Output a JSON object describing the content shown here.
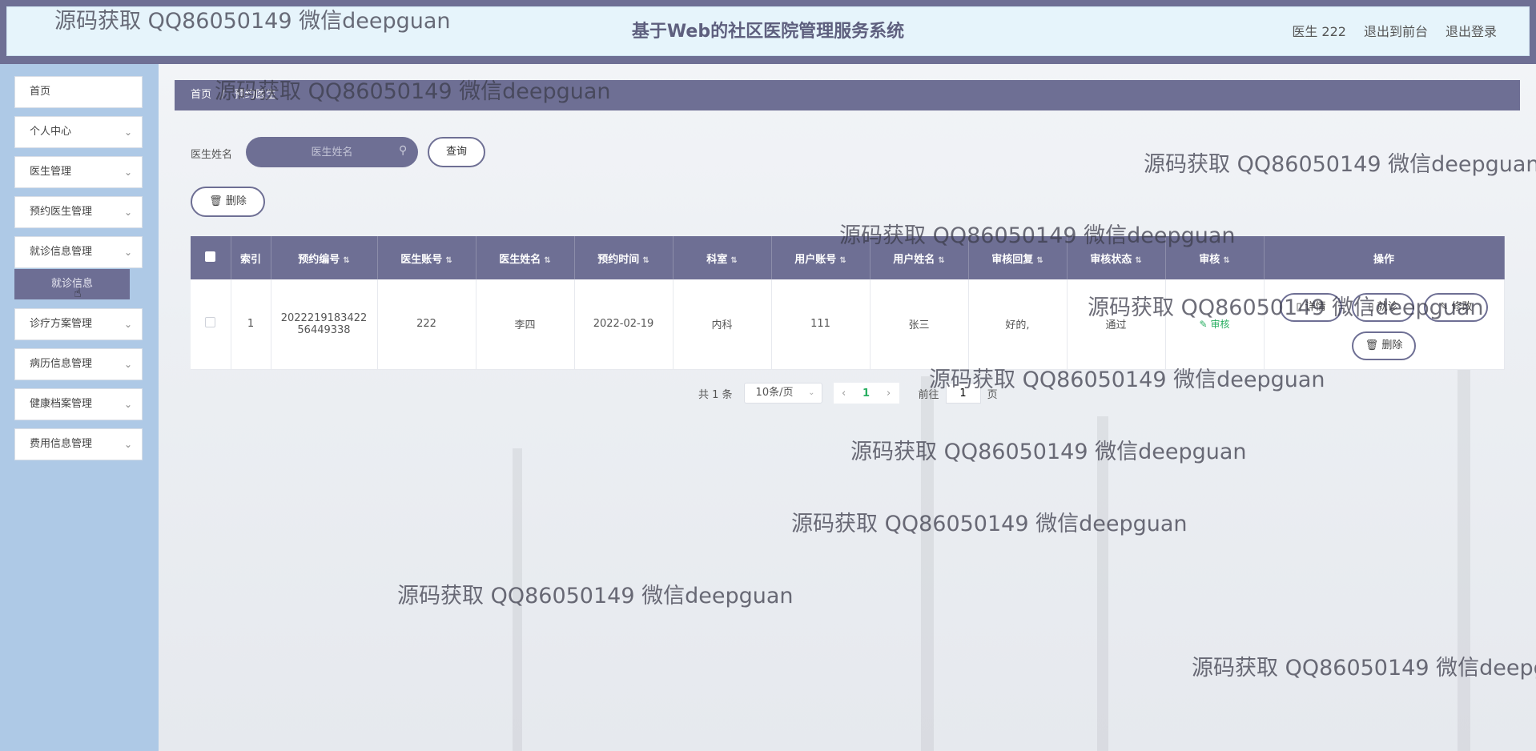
{
  "header": {
    "title": "基于Web的社区医院管理服务系统",
    "user_label": "医生 222",
    "frontend_link": "退出到前台",
    "logout_link": "退出登录"
  },
  "sidebar": {
    "items": [
      {
        "label": "首页",
        "has_arrow": false
      },
      {
        "label": "个人中心",
        "has_arrow": true
      },
      {
        "label": "医生管理",
        "has_arrow": true
      },
      {
        "label": "预约医生管理",
        "has_arrow": true
      },
      {
        "label": "就诊信息管理",
        "has_arrow": true
      },
      {
        "label": "诊疗方案管理",
        "has_arrow": true
      },
      {
        "label": "病历信息管理",
        "has_arrow": true
      },
      {
        "label": "健康档案管理",
        "has_arrow": true
      },
      {
        "label": "费用信息管理",
        "has_arrow": true
      }
    ],
    "submenu_item": "就诊信息"
  },
  "breadcrumb": {
    "home": "首页",
    "current": "预约医生"
  },
  "search": {
    "label": "医生姓名",
    "placeholder": "医生姓名",
    "query_button": "查询"
  },
  "toolbar": {
    "delete_button": "删除"
  },
  "table": {
    "headers": [
      "索引",
      "预约编号",
      "医生账号",
      "医生姓名",
      "预约时间",
      "科室",
      "用户账号",
      "用户姓名",
      "审核回复",
      "审核状态",
      "审核",
      "操作"
    ],
    "rows": [
      {
        "index": "1",
        "booking_no_line1": "2022219183422",
        "booking_no_line2": "56449338",
        "doctor_account": "222",
        "doctor_name": "李四",
        "booking_time": "2022-02-19",
        "department": "内科",
        "user_account": "111",
        "user_name": "张三",
        "audit_reply": "好的,",
        "audit_status": "通过",
        "audit_action": "审核"
      }
    ],
    "row_actions": [
      "详情",
      "就诊",
      "修改",
      "删除"
    ]
  },
  "pagination": {
    "total_text": "共 1 条",
    "page_size": "10条/页",
    "current_page": "1",
    "goto_prefix": "前往",
    "goto_value": "1",
    "goto_suffix": "页"
  },
  "watermark": "源码获取 QQ86050149 微信deepguan",
  "colors": {
    "primary": "#6e6f94",
    "sidebar": "#aec9e6",
    "header_bg": "#e6f4fb",
    "success": "#27ae60"
  }
}
